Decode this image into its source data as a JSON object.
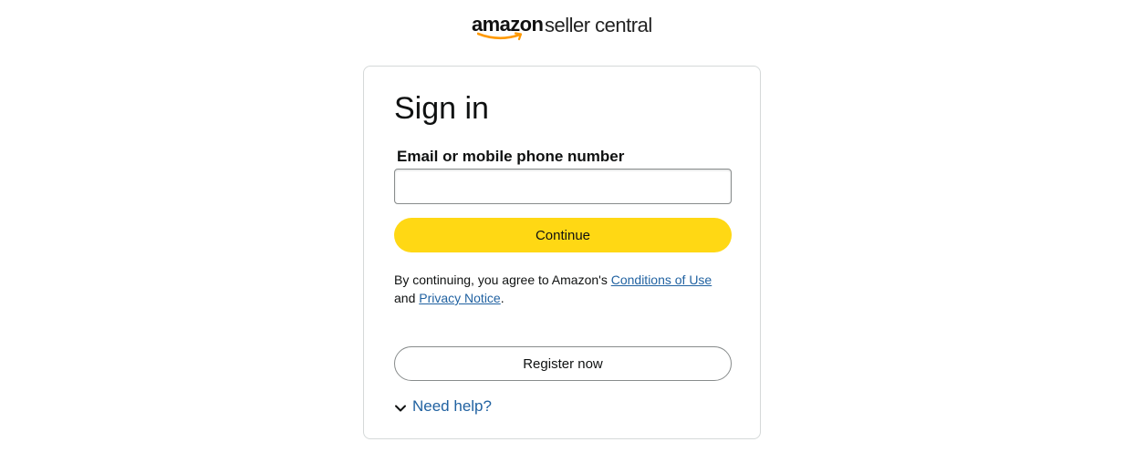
{
  "brand": {
    "logo_primary": "amazon",
    "logo_secondary": "seller central",
    "accent_color": "#ff9900"
  },
  "signin": {
    "title": "Sign in",
    "email_label": "Email or mobile phone number",
    "email_value": "",
    "continue_label": "Continue",
    "legal_prefix": "By continuing, you agree to Amazon's ",
    "conditions_link": "Conditions of Use",
    "legal_mid": " and ",
    "privacy_link": "Privacy Notice",
    "legal_suffix": ".",
    "register_label": "Register now",
    "help_label": "Need help?",
    "help_icon": "chevron-down-icon"
  },
  "colors": {
    "button_primary": "#ffd814",
    "link": "#2162a1",
    "border": "#d5d9d9"
  }
}
